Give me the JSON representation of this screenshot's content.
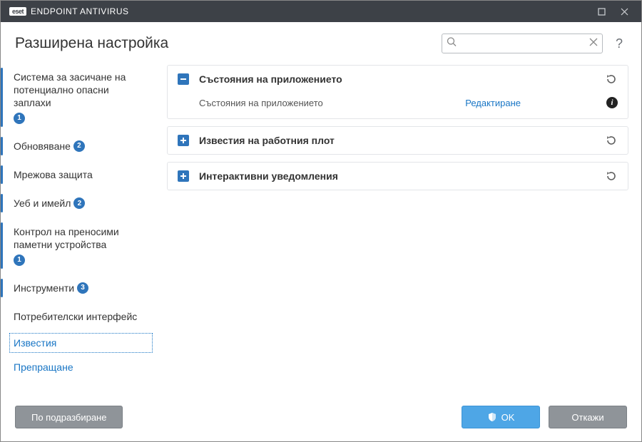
{
  "window": {
    "brand_badge": "eset",
    "brand_title": "ENDPOINT ANTIVIRUS"
  },
  "header": {
    "title": "Разширена настройка",
    "search_placeholder": "",
    "help": "?"
  },
  "sidebar": {
    "items": [
      {
        "label": "Система за засичане на потенциално опасни заплахи",
        "badge": "1"
      },
      {
        "label": "Обновяване",
        "badge": "2"
      },
      {
        "label": "Мрежова защита",
        "badge": null
      },
      {
        "label": "Уеб и имейл",
        "badge": "2"
      },
      {
        "label": "Контрол на преносими паметни устройства",
        "badge": "1"
      },
      {
        "label": "Инструменти",
        "badge": "3"
      },
      {
        "label": "Потребителски интерфейс",
        "badge": null
      }
    ],
    "sub": [
      {
        "label": "Известия",
        "selected": true
      },
      {
        "label": "Препращане",
        "selected": false
      }
    ]
  },
  "panels": [
    {
      "title": "Състояния на приложението",
      "expanded": true,
      "row": {
        "label": "Състояния на приложението",
        "action": "Редактиране"
      }
    },
    {
      "title": "Известия на работния плот",
      "expanded": false
    },
    {
      "title": "Интерактивни уведомления",
      "expanded": false
    }
  ],
  "footer": {
    "default": "По подразбиране",
    "ok": "OK",
    "cancel": "Откажи"
  }
}
